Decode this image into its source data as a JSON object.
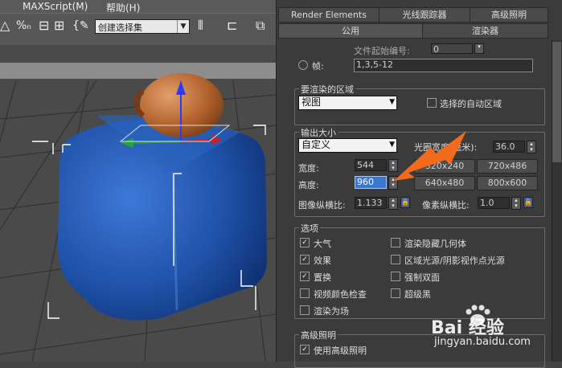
{
  "menubar": {
    "item1": "MAXScript(M)",
    "item2": "帮助(H)"
  },
  "toolbar": {
    "selection_set": "创建选择集"
  },
  "tabs_row1": [
    "Render Elements",
    "光线跟踪器",
    "高级照明"
  ],
  "tabs_row2": [
    "公用",
    "渲染器"
  ],
  "frames": {
    "files_label": "文件起始编号:",
    "files_value": "0",
    "frames_label": "帧:",
    "frames_value": "1,3,5-12"
  },
  "render_area": {
    "title": "要渲染的区域",
    "dropdown": "视图",
    "auto_region": "选择的自动区域"
  },
  "output_size": {
    "title": "输出大小",
    "dropdown": "自定义",
    "aperture_label": "光圈宽度(毫米):",
    "aperture_value": "36.0",
    "width_label": "宽度:",
    "width_value": "544",
    "height_label": "高度:",
    "height_value": "960",
    "presets": [
      "320x240",
      "720x486",
      "640x480",
      "800x600"
    ],
    "image_aspect_label": "图像纵横比:",
    "image_aspect_value": "1.133",
    "pixel_aspect_label": "像素纵横比:",
    "pixel_aspect_value": "1.0"
  },
  "options": {
    "title": "选项",
    "items": [
      {
        "label": "大气",
        "checked": true
      },
      {
        "label": "渲染隐藏几何体",
        "checked": false
      },
      {
        "label": "效果",
        "checked": true
      },
      {
        "label": "区域光源/阴影视作点光源",
        "checked": false
      },
      {
        "label": "置换",
        "checked": true
      },
      {
        "label": "强制双面",
        "checked": false
      },
      {
        "label": "视频颜色检查",
        "checked": false
      },
      {
        "label": "超级黑",
        "checked": false
      },
      {
        "label": "渲染为场",
        "checked": false
      }
    ]
  },
  "advanced_lighting": {
    "title": "高级照明",
    "use_label": "使用高级照明",
    "use_checked": true
  },
  "watermark": {
    "brand": "Bai 经验",
    "url": "jingyan.baidu.com"
  },
  "colors": {
    "arrow": "#f26a1b",
    "box": "#1f52a8",
    "teapot": "#b0602a"
  }
}
